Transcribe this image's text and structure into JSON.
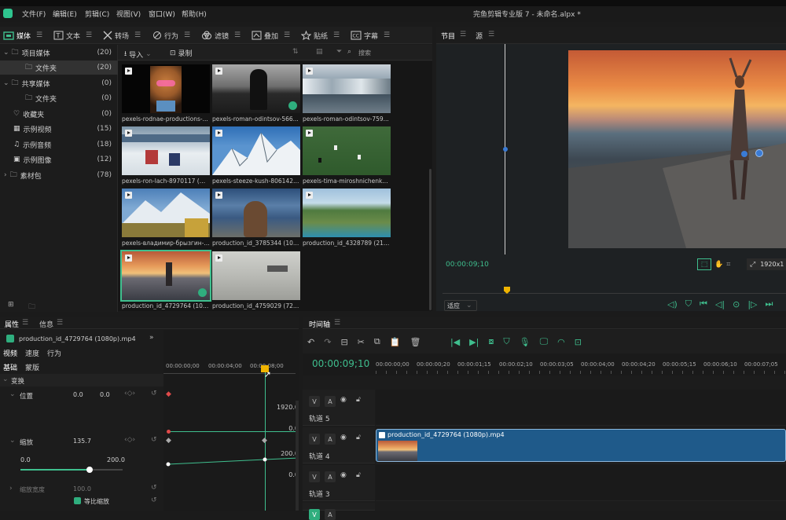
{
  "menubar": {
    "items": [
      "文件(F)",
      "编辑(E)",
      "剪辑(C)",
      "视图(V)",
      "窗口(W)",
      "帮助(H)"
    ],
    "app_title": "完鱼剪辑专业版 7 - 未命名.alpx *"
  },
  "toolbar": {
    "tabs": [
      {
        "label": "媒体",
        "icon": "media-icon"
      },
      {
        "label": "文本",
        "icon": "text-icon"
      },
      {
        "label": "转场",
        "icon": "transition-icon"
      },
      {
        "label": "行为",
        "icon": "behavior-icon"
      },
      {
        "label": "滤镜",
        "icon": "filter-icon"
      },
      {
        "label": "叠加",
        "icon": "overlay-icon"
      },
      {
        "label": "贴纸",
        "icon": "sticker-icon"
      },
      {
        "label": "字幕",
        "icon": "subtitle-icon"
      }
    ]
  },
  "tree": {
    "items": [
      {
        "label": "项目媒体",
        "count": "(20)"
      },
      {
        "label": "文件夹",
        "count": "(20)"
      },
      {
        "label": "共享媒体",
        "count": "(0)"
      },
      {
        "label": "文件夹",
        "count": "(0)"
      },
      {
        "label": "收藏夹",
        "count": "(0)"
      },
      {
        "label": "示例视频",
        "count": "(15)"
      },
      {
        "label": "示例音频",
        "count": "(18)"
      },
      {
        "label": "示例图像",
        "count": "(12)"
      },
      {
        "label": "素材包",
        "count": "(78)"
      }
    ]
  },
  "media": {
    "import_label": "导入",
    "record_label": "录制",
    "search_placeholder": "搜索",
    "items": [
      "pexels-rodnae-productions-...",
      "pexels-roman-odintsov-566...",
      "pexels-roman-odintsov-759...",
      "pexels-ron-lach-8970117 (Or...",
      "pexels-steeze-kush-8061421 ...",
      "pexels-tima-miroshnichenko...",
      "pexels-владимир-брызгин-...",
      "production_id_3785344 (108...",
      "production_id_4328789 (216...",
      "production_id_4729764 (108...",
      "production_id_4759029 (720..."
    ]
  },
  "preview": {
    "tabs": [
      "节目",
      "源"
    ],
    "timecode": "00:00:09;10",
    "fit_label": "适应",
    "resolution": "1920x1"
  },
  "props": {
    "tabs": [
      "属性",
      "信息"
    ],
    "clip_name": "production_id_4729764 (1080p).mp4",
    "subtabs": [
      "视频",
      "速度",
      "行为"
    ],
    "subtabs2": [
      "基础",
      "蒙版"
    ],
    "section": "变换",
    "position_label": "位置",
    "position_x": "0.0",
    "position_y": "0.0",
    "scale_label": "缩放",
    "scale_value": "135.7",
    "scale_min": "0.0",
    "scale_max": "200.0",
    "scale_width_label": "缩放宽度",
    "scale_width_value": "100.0",
    "proportional_label": "等比缩放",
    "graph1_top": "1920.0",
    "graph1_bottom": "0.0",
    "graph2_top": "200.0",
    "graph2_bottom": "0.0",
    "ruler": [
      "00:00:00;00",
      "00:00:04;00",
      "00:00:08;00"
    ]
  },
  "timeline": {
    "title": "时间轴",
    "timecode": "00:00:09;10",
    "ruler": [
      "00:00:00;00",
      "00:00:00;20",
      "00:00:01;15",
      "00:00:02;10",
      "00:00:03;05",
      "00:00:04;00",
      "00:00:04;20",
      "00:00:05;15",
      "00:00:06;10",
      "00:00:07;05"
    ],
    "tracks": [
      "轨道 5",
      "轨道 4",
      "轨道 3"
    ],
    "clip_title": "production_id_4729764 (1080p).mp4",
    "track_buttons": [
      "V",
      "A"
    ]
  }
}
